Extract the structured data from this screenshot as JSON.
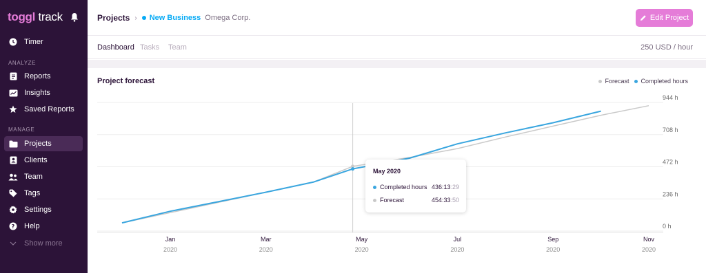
{
  "sidebar": {
    "logo_brand": "toggl",
    "logo_suffix": "track",
    "timer": "Timer",
    "analyze_heading": "ANALYZE",
    "analyze_items": [
      "Reports",
      "Insights",
      "Saved Reports"
    ],
    "manage_heading": "MANAGE",
    "manage_items": [
      "Projects",
      "Clients",
      "Team",
      "Tags",
      "Settings",
      "Help"
    ],
    "show_more": "Show more",
    "active_item": "Projects"
  },
  "header": {
    "breadcrumb_root": "Projects",
    "project_name": "New Business",
    "client_name": "Omega Corp.",
    "edit_button": "Edit Project"
  },
  "tabs": {
    "items": [
      "Dashboard",
      "Tasks",
      "Team"
    ],
    "active": "Dashboard",
    "rate": "250 USD / hour"
  },
  "forecast": {
    "title": "Project forecast",
    "legend_forecast": "Forecast",
    "legend_completed": "Completed hours",
    "tooltip": {
      "title": "May 2020",
      "completed_label": "Completed hours",
      "completed_main": "436:13",
      "completed_sec": ":29",
      "forecast_label": "Forecast",
      "forecast_main": "454:33",
      "forecast_sec": ":50"
    }
  },
  "colors": {
    "sidebar_bg": "#2c1338",
    "accent_pink": "#e57cd8",
    "completed_blue": "#3aa6df",
    "forecast_gray": "#c9c9c9",
    "project_blue": "#06aaf5"
  },
  "chart_data": {
    "type": "line",
    "title": "Project forecast",
    "x_ticks": [
      {
        "month": "Jan",
        "year": "2020"
      },
      {
        "month": "Mar",
        "year": "2020"
      },
      {
        "month": "May",
        "year": "2020"
      },
      {
        "month": "Jul",
        "year": "2020"
      },
      {
        "month": "Sep",
        "year": "2020"
      },
      {
        "month": "Nov",
        "year": "2020"
      }
    ],
    "y_ticks": [
      "944 h",
      "708 h",
      "472 h",
      "236 h",
      "0 h"
    ],
    "y_tick_values": [
      944,
      708,
      472,
      236,
      0
    ],
    "ylim": [
      0,
      944
    ],
    "grid": true,
    "legend_position": "top-right",
    "x": [
      "2019-12",
      "2020-01",
      "2020-02",
      "2020-03",
      "2020-04",
      "2020-05",
      "2020-06",
      "2020-07",
      "2020-08",
      "2020-09",
      "2020-10",
      "2020-11"
    ],
    "series": [
      {
        "name": "Forecast",
        "color": "#c9c9c9",
        "values": [
          40,
          115,
          190,
          265,
          340,
          455,
          520,
          585,
          670,
          750,
          830,
          900
        ]
      },
      {
        "name": "Completed hours",
        "color": "#3aa6df",
        "values": [
          40,
          125,
          195,
          265,
          340,
          436,
          515,
          620,
          700,
          775,
          860,
          null
        ]
      }
    ],
    "hover_x": "2020-05"
  }
}
